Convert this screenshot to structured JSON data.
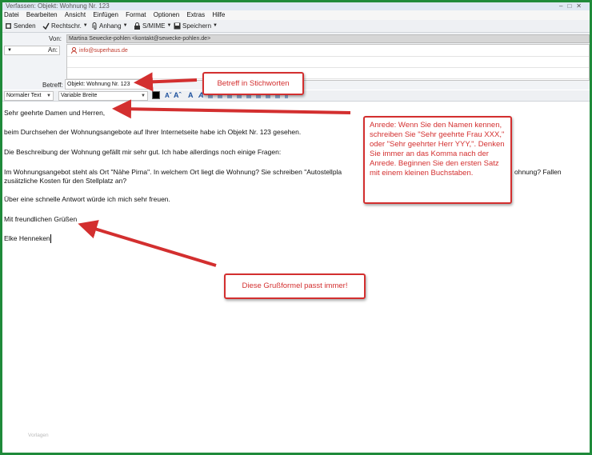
{
  "window": {
    "title": "Verfassen: Objekt: Wohnung Nr. 123"
  },
  "menu": [
    "Datei",
    "Bearbeiten",
    "Ansicht",
    "Einfügen",
    "Format",
    "Optionen",
    "Extras",
    "Hilfe"
  ],
  "toolbar": {
    "send": "Senden",
    "spell": "Rechtschr.",
    "attach": "Anhang",
    "smime": "S/MIME",
    "save": "Speichern"
  },
  "header": {
    "from_label": "Von:",
    "from_value": "Martina Sewecke-pohlen <kontakt@sewecke-pohlen.de>",
    "to_label": "An:",
    "to_value": "info@superhaus.de",
    "subject_label": "Betreff:",
    "subject_value": "Objekt: Wohnung Nr. 123"
  },
  "format": {
    "style": "Normaler Text",
    "font": "Variable Breite"
  },
  "body": [
    "Sehr geehrte Damen und Herren,",
    "beim Durchsehen der Wohnungsangebote auf Ihrer Internetseite habe ich Objekt Nr. 123 gesehen.",
    "Die Beschreibung der Wohnung gefällt mir sehr gut. Ich habe allerdings noch einige Fragen:",
    "Im Wohnungsangebot steht als Ort \"Nähe Pirna\". In welchem Ort liegt die Wohnung? Sie schreiben \"Autostellpla",
    "ohnung? Fallen",
    "zusätzliche Kosten für den Stellplatz an?",
    "Über eine schnelle Antwort würde ich mich sehr freuen.",
    "Mit freundlichen Grüßen",
    "Elke Henneken"
  ],
  "watermark": "Vorlagen",
  "callouts": {
    "subject": "Betreff in Stichworten",
    "salutation": "Anrede: Wenn Sie den Namen kennen, schreiben Sie \"Sehr geehrte Frau XXX,\" oder \"Sehr geehrter Herr YYY,\". Denken Sie immer an das Komma nach der Anrede. Beginnen Sie den ersten Satz mit einem kleinen Buchstaben.",
    "closing": "Diese Grußformel passt immer!"
  },
  "colors": {
    "frame": "#1f8a3a",
    "callout": "#d32f2f"
  }
}
